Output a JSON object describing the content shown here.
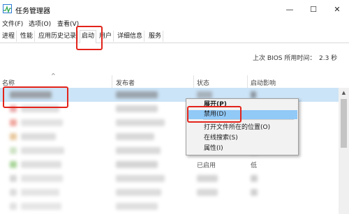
{
  "window": {
    "title": "任务管理器",
    "controls": {
      "minimize": "—",
      "maximize": "☐",
      "close": "✕"
    }
  },
  "menu": [
    "文件(F)",
    "选项(O)",
    "查看(V)"
  ],
  "tabs": [
    {
      "label": "进程"
    },
    {
      "label": "性能"
    },
    {
      "label": "应用历史记录"
    },
    {
      "label": "启动",
      "active": true
    },
    {
      "label": "用户"
    },
    {
      "label": "详细信息"
    },
    {
      "label": "服务"
    }
  ],
  "bios": {
    "label": "上次 BIOS 所用时间：",
    "value": "2.3 秒"
  },
  "columns": {
    "name": "名称",
    "publisher": "发布者",
    "status": "状态",
    "impact": "启动影响",
    "sort_indicator": "^"
  },
  "rows_visible_text": {
    "status_row_5": "已启用",
    "impact_row_5": "低"
  },
  "context_menu": {
    "items": [
      {
        "label": "展开(P)",
        "bold": true
      },
      {
        "label": "禁用(D)",
        "highlighted": true
      },
      {
        "label": "打开文件所在的位置(O)"
      },
      {
        "label": "在线搜索(S)"
      },
      {
        "label": "属性(I)"
      }
    ]
  },
  "colors": {
    "selection": "#cce4f7",
    "menu_highlight": "#91c9f7",
    "annotation": "#e3231a"
  }
}
